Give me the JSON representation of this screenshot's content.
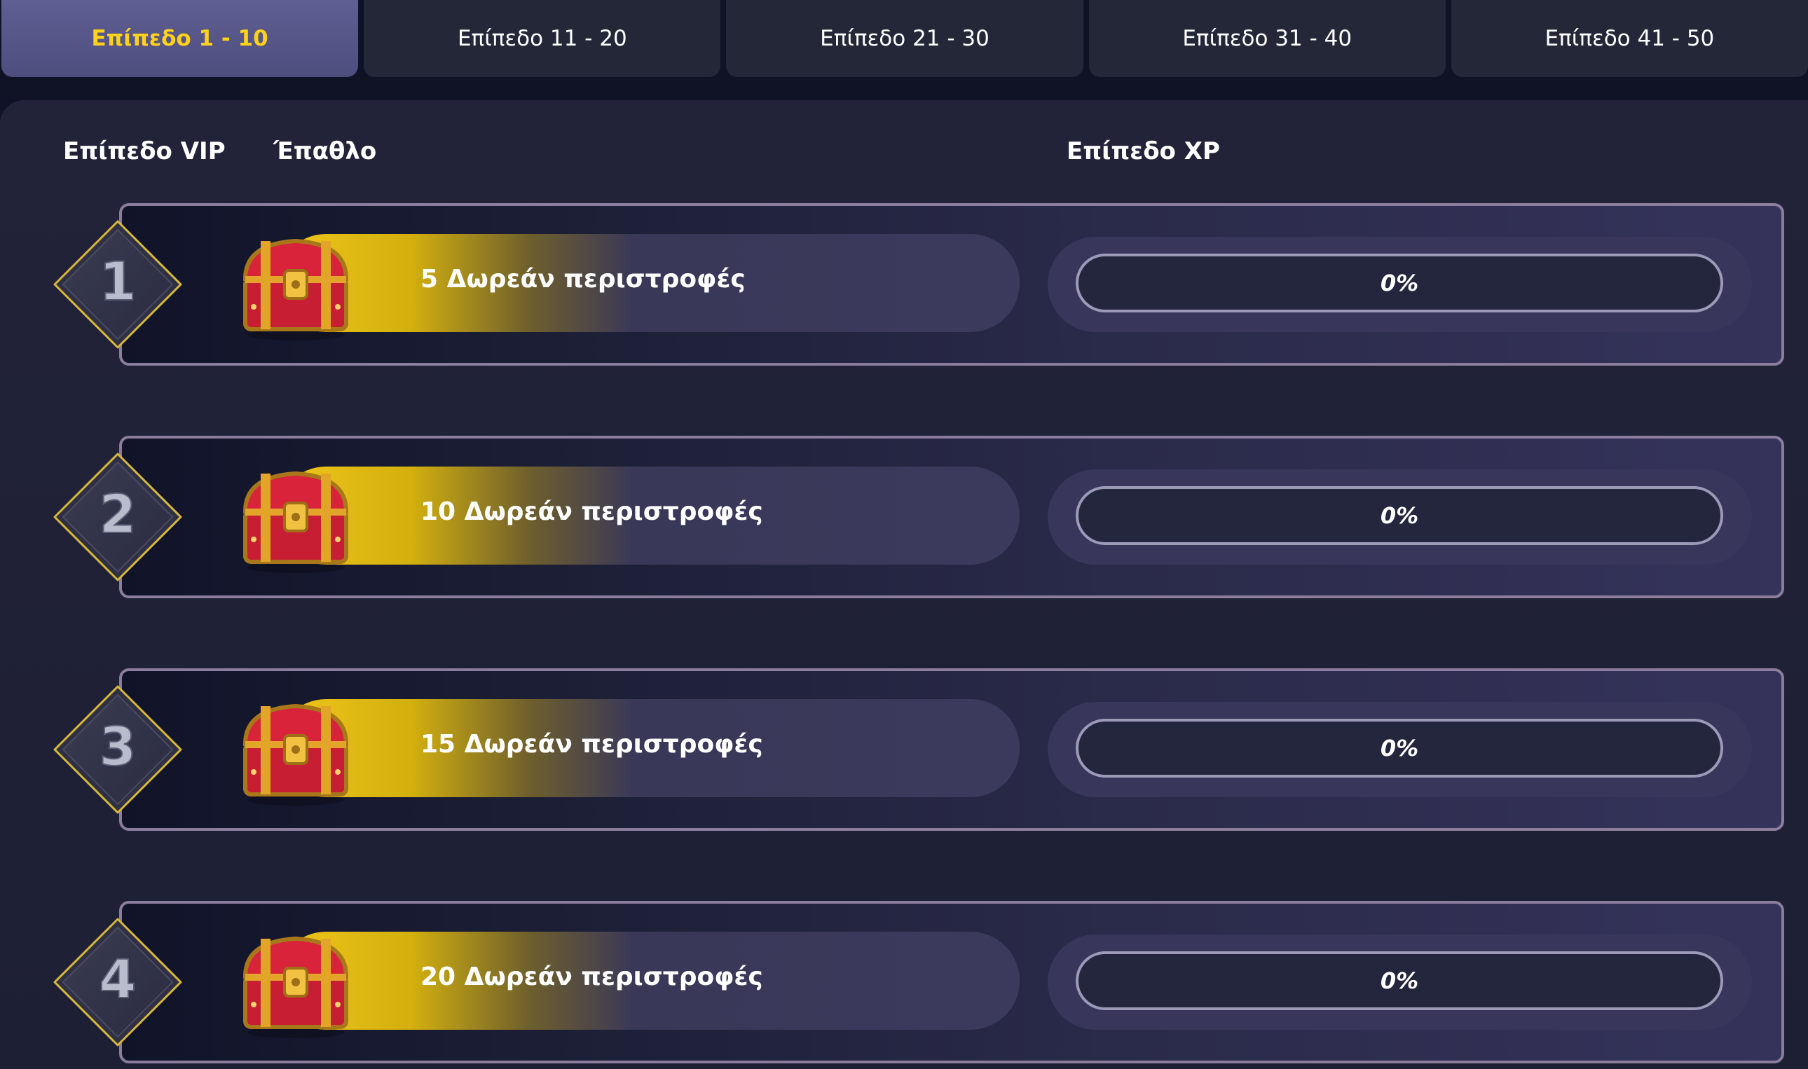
{
  "tabs": [
    {
      "label": "Επίπεδο 1 - 10",
      "active": true
    },
    {
      "label": "Επίπεδο 11 - 20",
      "active": false
    },
    {
      "label": "Επίπεδο 21 - 30",
      "active": false
    },
    {
      "label": "Επίπεδο 31 - 40",
      "active": false
    },
    {
      "label": "Επίπεδο 41 - 50",
      "active": false
    }
  ],
  "columns": {
    "vip_level": "Επίπεδο VIP",
    "reward": "Έπαθλο",
    "xp_level": "Επίπεδο XP"
  },
  "rows": [
    {
      "level": "1",
      "reward": "5 Δωρεάν περιστροφές",
      "xp_label": "0%",
      "xp_progress": 0
    },
    {
      "level": "2",
      "reward": "10 Δωρεάν περιστροφές",
      "xp_label": "0%",
      "xp_progress": 0
    },
    {
      "level": "3",
      "reward": "15 Δωρεάν περιστροφές",
      "xp_label": "0%",
      "xp_progress": 0
    },
    {
      "level": "4",
      "reward": "20 Δωρεάν περιστροφές",
      "xp_label": "0%",
      "xp_progress": 0
    }
  ],
  "colors": {
    "accent_gold": "#f0c61a",
    "active_tab": "#555587",
    "tab_bg": "#232738",
    "frame_border": "#8b7d9c"
  },
  "icons": {
    "level_badge": "diamond-level-badge-icon",
    "reward": "treasure-chest-icon"
  }
}
